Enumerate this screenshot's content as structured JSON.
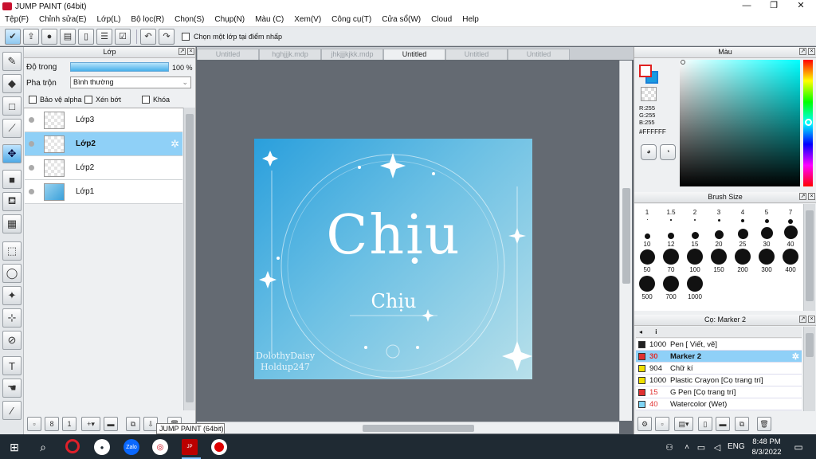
{
  "window": {
    "title": "JUMP PAINT (64bit)",
    "minimize": "—",
    "maximize": "❐",
    "close": "✕"
  },
  "menu": [
    "Tệp(F)",
    "Chỉnh sửa(E)",
    "Lớp(L)",
    "Bộ lọc(R)",
    "Chọn(S)",
    "Chụp(N)",
    "Màu (C)",
    "Xem(V)",
    "Công cụ(T)",
    "Cửa sổ(W)",
    "Cloud",
    "Help"
  ],
  "toolbar": {
    "select_layer_label": "Chọn một lớp tại điểm nhấp"
  },
  "layer_panel": {
    "title": "Lớp",
    "opacity_label": "Độ trong",
    "opacity_value": "100 %",
    "opacity_fraction": 1.0,
    "blend_label": "Pha trộn",
    "blend_value": "Bình thường",
    "protect_alpha": "Bảo vệ alpha",
    "clipping": "Xén bớt",
    "lock": "Khóa",
    "layers": [
      {
        "name": "Lớp3",
        "selected": false
      },
      {
        "name": "Lớp2",
        "selected": true
      },
      {
        "name": "Lớp2",
        "selected": false
      },
      {
        "name": "Lớp1",
        "selected": false
      }
    ]
  },
  "doc_tabs": [
    "Untitled",
    "hghjjjk.mdp",
    "jhkjjjkjkk.mdp",
    "Untitled",
    "Untitled",
    "Untitled"
  ],
  "active_doc_tab": 3,
  "canvas": {
    "main_text": "Chịu",
    "sub_text": "Chịu",
    "watermark_line1": "DolothyDaisy",
    "watermark_line2": "Holdup247"
  },
  "color_panel": {
    "title": "Màu",
    "r": "R:255",
    "g": "G:255",
    "b": "B:255",
    "hex": "#FFFFFF"
  },
  "brush_size_panel": {
    "title": "Brush Size",
    "sizes": [
      "1",
      "1.5",
      "2",
      "3",
      "4",
      "5",
      "7",
      "10",
      "12",
      "15",
      "20",
      "25",
      "30",
      "40",
      "50",
      "70",
      "100",
      "150",
      "200",
      "300",
      "400",
      "500",
      "700",
      "1000"
    ]
  },
  "brush_panel": {
    "title": "Cọ: Marker 2",
    "header_icon": "i",
    "brushes": [
      {
        "size": "1000",
        "name": "Pen [ Viết, vẽ]",
        "color": "#222222",
        "selected": false
      },
      {
        "size": "30",
        "name": "Marker 2",
        "color": "#e03030",
        "selected": true
      },
      {
        "size": "904",
        "name": "Chữ kí",
        "color": "#f0e000",
        "selected": false
      },
      {
        "size": "1000",
        "name": "Plastic Crayon [Cọ trang trí]",
        "color": "#f0e000",
        "selected": false
      },
      {
        "size": "15",
        "name": "G Pen [Cọ trang trí]",
        "color": "#e03030",
        "selected": false
      },
      {
        "size": "40",
        "name": "Watercolor (Wet)",
        "color": "#7fd4f4",
        "selected": false
      }
    ]
  },
  "tooltip": "JUMP PAINT (64bit)",
  "taskbar": {
    "ime": "ENG",
    "time": "8:48 PM",
    "date": "8/3/2022",
    "zalo": "Zalo"
  }
}
